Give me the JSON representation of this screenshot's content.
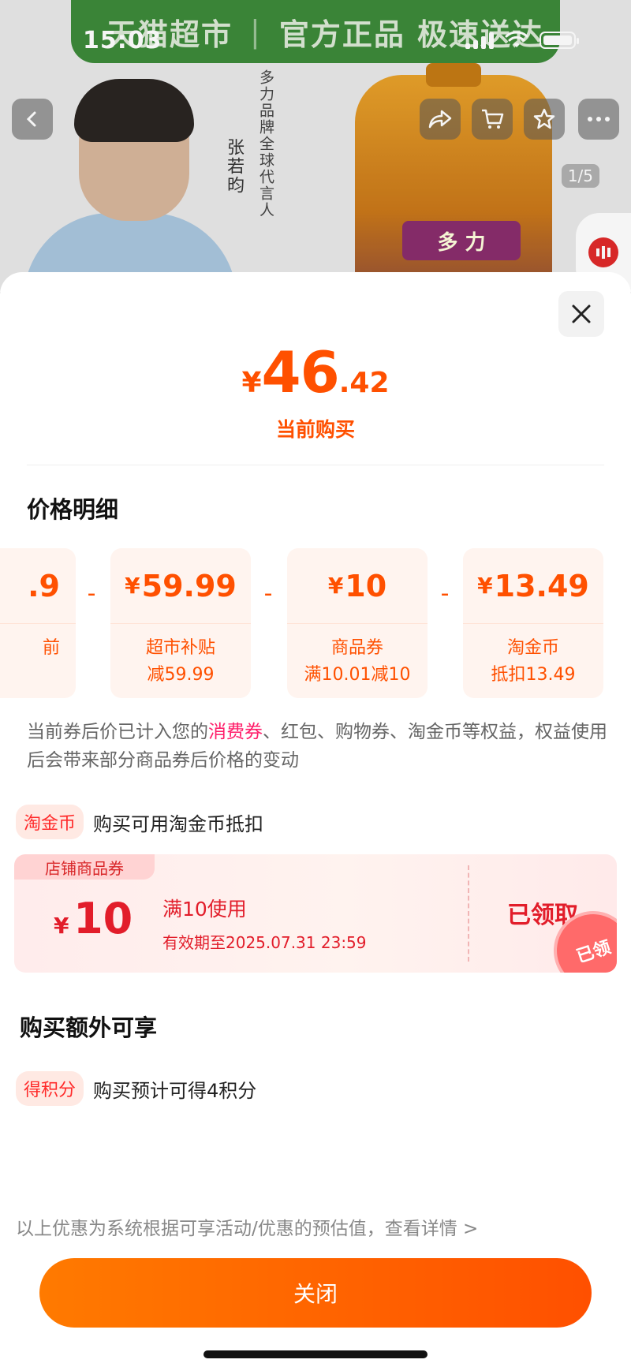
{
  "status_bar": {
    "time": "15:03"
  },
  "background": {
    "banner_title": "天猫超市",
    "banner_sep": "|",
    "banner_tagline": "官方正品 极速送达",
    "endorsement": "多力品牌全球代言人",
    "endorser_name": "张若昀",
    "bottle_brand": "多 力",
    "page_counter": "1/5",
    "icons": [
      "back-icon",
      "share-icon",
      "cart-icon",
      "star-icon",
      "more-icon"
    ]
  },
  "sheet": {
    "price_symbol": "¥",
    "price_int": "46",
    "price_dec": ".42",
    "price_caption": "当前购买",
    "breakdown_title": "价格明细",
    "breakdown": [
      {
        "value": ".9",
        "label": "前"
      },
      {
        "value": "¥59.99",
        "label1": "超市补贴",
        "label2": "减59.99"
      },
      {
        "value": "¥10",
        "label1": "商品券",
        "label2": "满10.01减10"
      },
      {
        "value": "¥13.49",
        "label1": "淘金币",
        "label2": "抵扣13.49"
      }
    ],
    "minus": "-",
    "note_pre": "当前券后价已计入您的",
    "note_hl": "消费券",
    "note_post": "、红包、购物券、淘金币等权益，权益使用后会带来部分商品券后价格的变动",
    "coin_tag": "淘金币",
    "coin_text": "购买可用淘金币抵扣",
    "coupon": {
      "tag": "店铺商品券",
      "symbol": "¥",
      "amount": "10",
      "condition": "满10使用",
      "validity": "有效期至2025.07.31 23:59",
      "status": "已领取",
      "stamp": "已领"
    },
    "extra_title": "购买额外可享",
    "points_tag": "得积分",
    "points_text": "购买预计可得4积分",
    "footer_note": "以上优惠为系统根据可享活动/优惠的预估值，查看详情 >",
    "close_label": "关闭"
  },
  "colors": {
    "accent": "#ff5000",
    "coupon_red": "#e21d2a",
    "highlight": "#ff1e6a"
  }
}
